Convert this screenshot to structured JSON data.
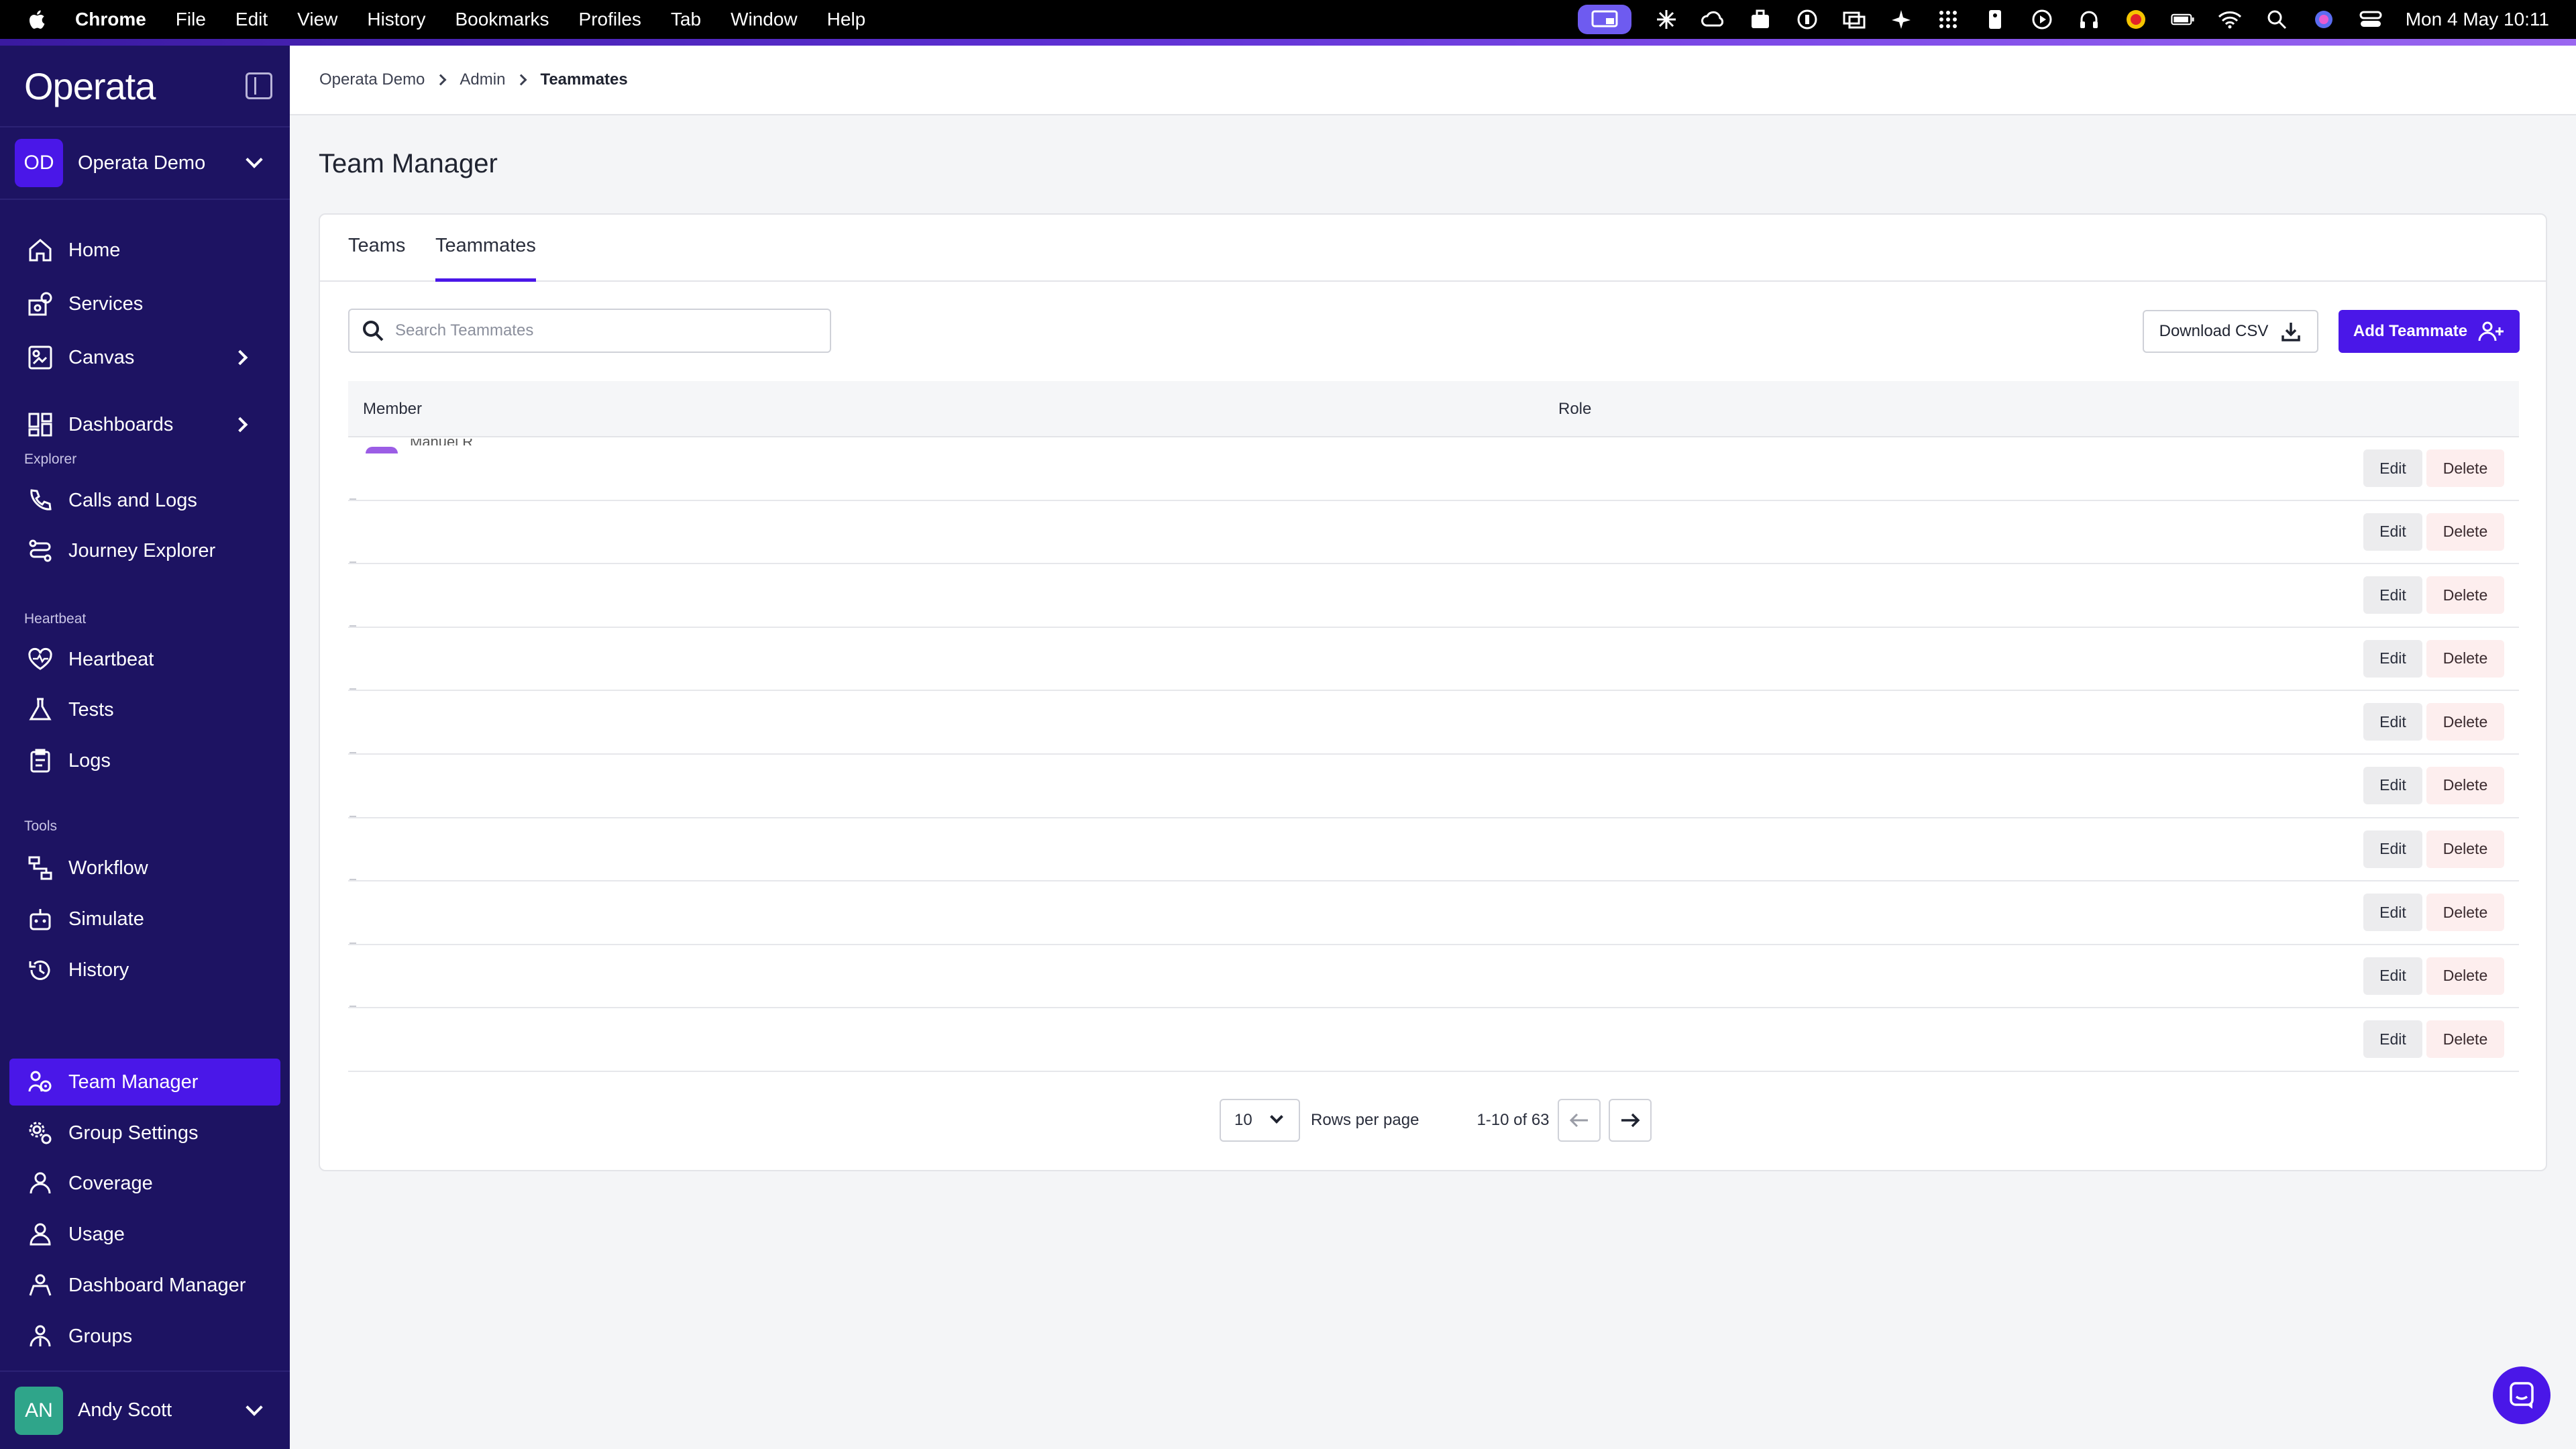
{
  "menubar": {
    "app": "Chrome",
    "items": [
      "File",
      "Edit",
      "View",
      "History",
      "Bookmarks",
      "Profiles",
      "Tab",
      "Window",
      "Help"
    ],
    "datetime": "Mon 4 May  10:11"
  },
  "sidebar": {
    "logo": "Operata",
    "org": {
      "initials": "OD",
      "name": "Operata Demo"
    },
    "items": [
      {
        "label": "Home"
      },
      {
        "label": "Services"
      },
      {
        "label": "Canvas"
      },
      {
        "label": "Dashboards"
      },
      {
        "label": "Calls and Logs"
      },
      {
        "label": "Journey Explorer"
      },
      {
        "label": "Heartbeat"
      },
      {
        "label": "Tests"
      },
      {
        "label": "Logs"
      },
      {
        "label": "Workflow"
      },
      {
        "label": "Simulate"
      },
      {
        "label": "History"
      },
      {
        "label": "Team Manager"
      },
      {
        "label": "Group Settings"
      },
      {
        "label": "Coverage"
      },
      {
        "label": "Usage"
      },
      {
        "label": "Dashboard Manager"
      },
      {
        "label": "Groups"
      }
    ],
    "sections": {
      "explorer": "Explorer",
      "heartbeat": "Heartbeat",
      "tools": "Tools"
    },
    "user": {
      "initials": "AN",
      "name": "Andy Scott"
    }
  },
  "breadcrumb": [
    "Operata Demo",
    "Admin",
    "Teammates"
  ],
  "page": {
    "title": "Team Manager"
  },
  "tabs": [
    "Teams",
    "Teammates"
  ],
  "search": {
    "placeholder": "Search Teammates",
    "value": ""
  },
  "actions": {
    "download": "Download CSV",
    "add": "Add Teammate"
  },
  "table": {
    "columns": [
      "Member",
      "Role"
    ],
    "first_row_partial": "Manuel R",
    "row_actions": {
      "edit": "Edit",
      "delete": "Delete"
    }
  },
  "pagination": {
    "rows_per_page": "10",
    "rows_label": "Rows per page",
    "range": "1-10 of 63"
  },
  "colors": {
    "primary": "#4a17e8",
    "sidebar_bg": "#1d1362"
  }
}
